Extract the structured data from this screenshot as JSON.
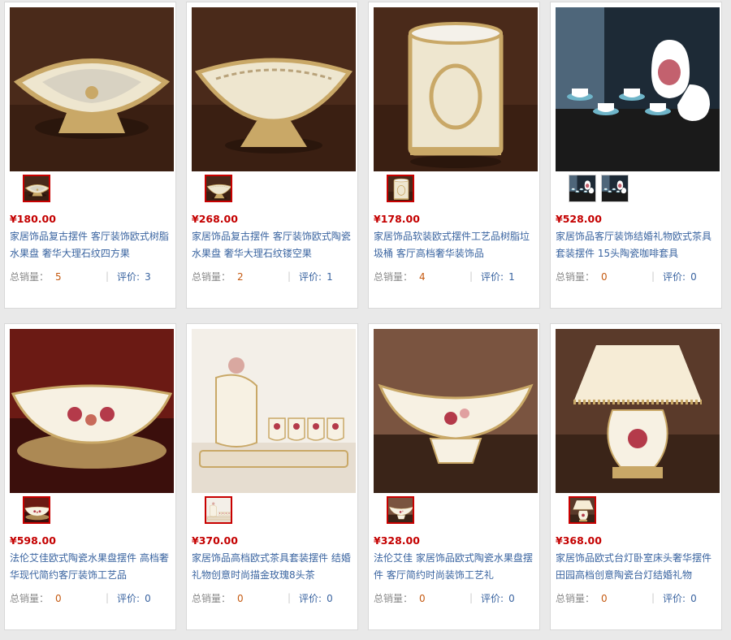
{
  "products": [
    {
      "price": "¥180.00",
      "title": "家居饰品复古摆件 客厅装饰欧式树脂水果盘 奢华大理石纹四方果",
      "sales_label": "总销量：",
      "sales": "5",
      "reviews_label": "评价:",
      "reviews": "3",
      "image": "square-fruit-tray",
      "thumbs": [
        "square-fruit-tray"
      ]
    },
    {
      "price": "¥268.00",
      "title": "家居饰品复古摆件 客厅装饰欧式陶瓷水果盘 奢华大理石纹镂空果",
      "sales_label": "总销量：",
      "sales": "2",
      "reviews_label": "评价:",
      "reviews": "1",
      "image": "openwork-fruit-bowl",
      "thumbs": [
        "openwork-fruit-bowl"
      ]
    },
    {
      "price": "¥178.00",
      "title": "家居饰品软装欧式摆件工艺品树脂垃圾桶 客厅高档奢华装饰品",
      "sales_label": "总销量：",
      "sales": "4",
      "reviews_label": "评价:",
      "reviews": "1",
      "image": "resin-waste-bin",
      "thumbs": [
        "resin-waste-bin"
      ]
    },
    {
      "price": "¥528.00",
      "title": "家居饰品客厅装饰结婚礼物欧式茶具套装摆件 15头陶瓷咖啡套具",
      "sales_label": "总销量：",
      "sales": "0",
      "reviews_label": "评价:",
      "reviews": "0",
      "image": "coffee-set-15pc",
      "thumbs": [
        "coffee-set-a",
        "coffee-set-b"
      ]
    },
    {
      "price": "¥598.00",
      "title": "法伦艾佳欧式陶瓷水果盘摆件 高档奢华现代简约客厅装饰工艺品",
      "sales_label": "总销量：",
      "sales": "0",
      "reviews_label": "评价:",
      "reviews": "0",
      "image": "ceramic-fruit-dish",
      "thumbs": [
        "ceramic-fruit-dish"
      ]
    },
    {
      "price": "¥370.00",
      "title": "家居饰品高档欧式茶具套装摆件 结婚礼物创意时尚描金玫瑰8头茶",
      "sales_label": "总销量：",
      "sales": "0",
      "reviews_label": "评价:",
      "reviews": "0",
      "image": "rose-tea-set",
      "thumbs": [
        "rose-tea-set"
      ]
    },
    {
      "price": "¥328.00",
      "title": "法伦艾佳 家居饰品欧式陶瓷水果盘摆件 客厅简约时尚装饰工艺礼",
      "sales_label": "总销量：",
      "sales": "0",
      "reviews_label": "评价:",
      "reviews": "0",
      "image": "floral-fruit-boat",
      "thumbs": [
        "floral-fruit-boat"
      ]
    },
    {
      "price": "¥368.00",
      "title": "家居饰品欧式台灯卧室床头奢华摆件田园高档创意陶瓷台灯结婚礼物",
      "sales_label": "总销量：",
      "sales": "0",
      "reviews_label": "评价:",
      "reviews": "0",
      "image": "ceramic-table-lamp",
      "thumbs": [
        "ceramic-table-lamp"
      ]
    }
  ]
}
